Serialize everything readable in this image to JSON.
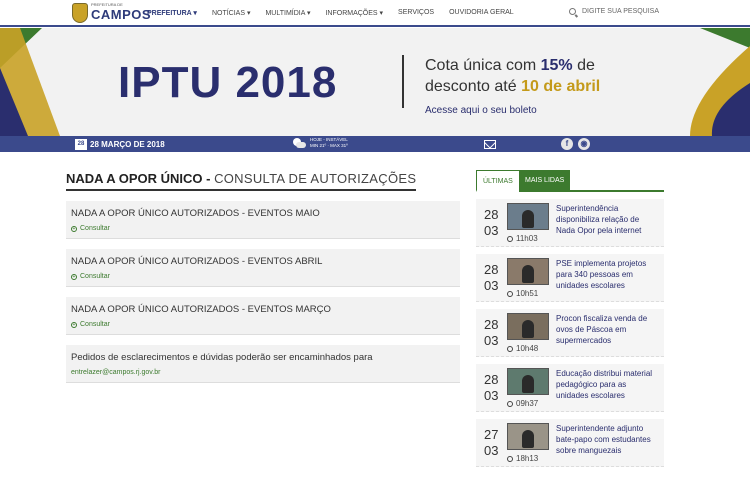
{
  "header": {
    "logo_small": "PREFEITURA DE",
    "logo_big": "CAMPOS",
    "nav": [
      {
        "label": "PREFEITURA ▾",
        "active": true
      },
      {
        "label": "NOTÍCIAS ▾",
        "active": false
      },
      {
        "label": "MULTIMÍDIA ▾",
        "active": false
      },
      {
        "label": "INFORMAÇÕES ▾",
        "active": false
      },
      {
        "label": "SERVIÇOS",
        "active": false
      },
      {
        "label": "OUVIDORIA GERAL",
        "active": false
      }
    ],
    "search_placeholder": "DIGITE SUA PESQUISA"
  },
  "banner": {
    "title": "IPTU 2018",
    "line1_a": "Cota única com ",
    "line1_b": "15%",
    "line1_c": " de",
    "line2_a": "desconto até ",
    "line2_b": "10 de abril",
    "link": "Acesse aqui o seu boleto"
  },
  "strip": {
    "cal_day": "28",
    "date": "28 MARÇO DE 2018",
    "weather_l1": "HOJE - INSTÁVEL",
    "weather_l2": "MIN 21º · MAX 31º",
    "fb": "f",
    "rss": "◉"
  },
  "main": {
    "title_bold": "NADA A OPOR ÚNICO - ",
    "title_sub": "CONSULTA DE AUTORIZAÇÕES",
    "items": [
      {
        "heading": "NADA A OPOR ÚNICO AUTORIZADOS - EVENTOS MAIO",
        "link": "Consultar"
      },
      {
        "heading": "NADA A OPOR ÚNICO AUTORIZADOS - EVENTOS ABRIL",
        "link": "Consultar"
      },
      {
        "heading": "NADA A OPOR ÚNICO AUTORIZADOS - EVENTOS MARÇO",
        "link": "Consultar"
      }
    ],
    "info_text": "Pedidos de esclarecimentos e dúvidas poderão ser encaminhados para",
    "info_email": "entrelazer@campos.rj.gov.br"
  },
  "sidebar": {
    "tabs": [
      "ÚLTIMAS",
      "MAIS LIDAS"
    ],
    "news": [
      {
        "day": "28",
        "month": "03",
        "time": "11h03",
        "headline": "Superintendência disponibiliza relação de Nada Opor pela internet"
      },
      {
        "day": "28",
        "month": "03",
        "time": "10h51",
        "headline": "PSE implementa projetos para 340 pessoas em unidades escolares"
      },
      {
        "day": "28",
        "month": "03",
        "time": "10h48",
        "headline": "Procon fiscaliza venda de ovos de Páscoa em supermercados"
      },
      {
        "day": "28",
        "month": "03",
        "time": "09h37",
        "headline": "Educação distribui material pedagógico para as unidades escolares"
      },
      {
        "day": "27",
        "month": "03",
        "time": "18h13",
        "headline": "Superintendente adjunto bate-papo com estudantes sobre manguezais"
      }
    ]
  }
}
